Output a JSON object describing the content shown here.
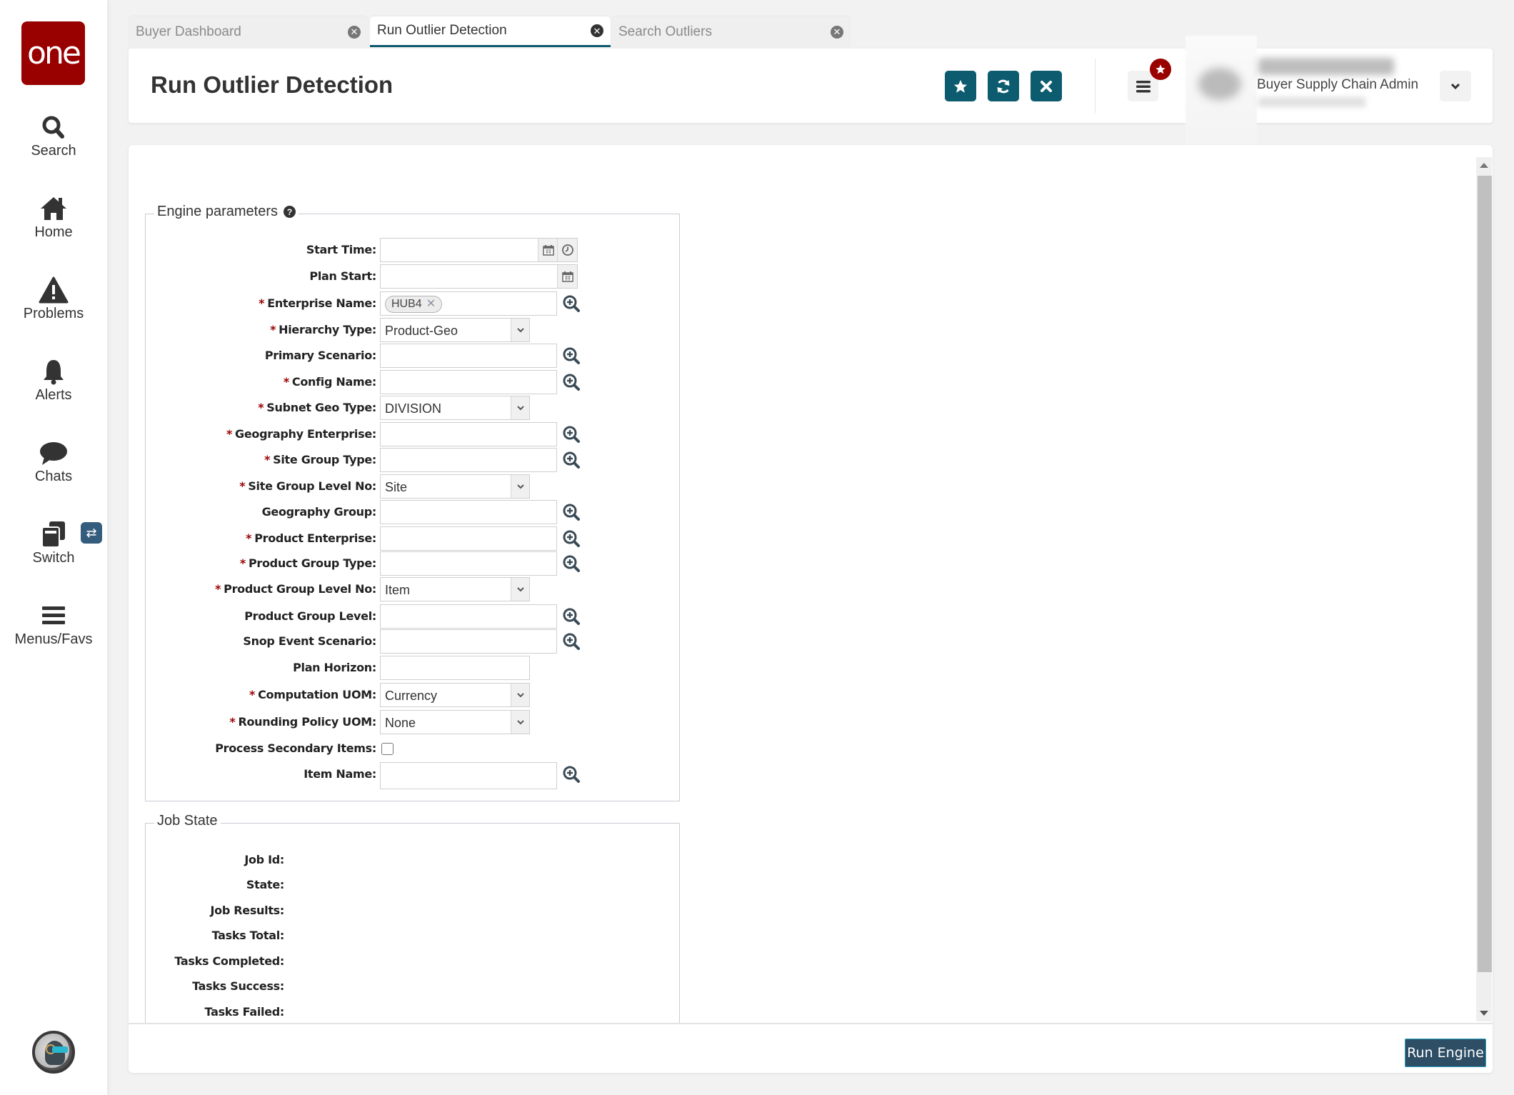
{
  "sidebar": {
    "logo_text": "one",
    "items": [
      {
        "label": "Search",
        "icon": "search-icon"
      },
      {
        "label": "Home",
        "icon": "home-icon"
      },
      {
        "label": "Problems",
        "icon": "warning-icon"
      },
      {
        "label": "Alerts",
        "icon": "bell-icon"
      },
      {
        "label": "Chats",
        "icon": "chat-icon"
      },
      {
        "label": "Switch",
        "icon": "switch-icon"
      },
      {
        "label": "Menus/Favs",
        "icon": "menu-icon"
      }
    ],
    "switch_badge": "⇄"
  },
  "tabs": [
    {
      "label": "Buyer Dashboard",
      "active": false
    },
    {
      "label": "Run Outlier Detection",
      "active": true
    },
    {
      "label": "Search Outliers",
      "active": false
    }
  ],
  "header": {
    "title": "Run Outlier Detection",
    "user_role": "Buyer Supply Chain Admin",
    "colors": {
      "accent": "#0d5b6e",
      "badge": "#990000",
      "brand": "#990000"
    }
  },
  "engine_parameters": {
    "legend": "Engine parameters",
    "fields": [
      {
        "label": "Start Time:",
        "required": false,
        "type": "datetime",
        "value": ""
      },
      {
        "label": "Plan Start:",
        "required": false,
        "type": "date",
        "value": ""
      },
      {
        "label": "Enterprise Name:",
        "required": true,
        "type": "chip-lookup",
        "value": "HUB4"
      },
      {
        "label": "Hierarchy Type:",
        "required": true,
        "type": "select",
        "value": "Product-Geo"
      },
      {
        "label": "Primary Scenario:",
        "required": false,
        "type": "lookup",
        "value": ""
      },
      {
        "label": "Config Name:",
        "required": true,
        "type": "lookup",
        "value": ""
      },
      {
        "label": "Subnet Geo Type:",
        "required": true,
        "type": "select",
        "value": "DIVISION"
      },
      {
        "label": "Geography Enterprise:",
        "required": true,
        "type": "lookup",
        "value": ""
      },
      {
        "label": "Site Group Type:",
        "required": true,
        "type": "lookup",
        "value": ""
      },
      {
        "label": "Site Group Level No:",
        "required": true,
        "type": "select",
        "value": "Site"
      },
      {
        "label": "Geography Group:",
        "required": false,
        "type": "lookup",
        "value": ""
      },
      {
        "label": "Product Enterprise:",
        "required": true,
        "type": "lookup",
        "value": ""
      },
      {
        "label": "Product Group Type:",
        "required": true,
        "type": "lookup",
        "value": ""
      },
      {
        "label": "Product Group Level No:",
        "required": true,
        "type": "select",
        "value": "Item"
      },
      {
        "label": "Product Group Level:",
        "required": false,
        "type": "lookup",
        "value": ""
      },
      {
        "label": "Snop Event Scenario:",
        "required": false,
        "type": "lookup",
        "value": ""
      },
      {
        "label": "Plan Horizon:",
        "required": false,
        "type": "text",
        "value": ""
      },
      {
        "label": "Computation UOM:",
        "required": true,
        "type": "select",
        "value": "Currency"
      },
      {
        "label": "Rounding Policy UOM:",
        "required": true,
        "type": "select",
        "value": "None"
      },
      {
        "label": "Process Secondary Items:",
        "required": false,
        "type": "checkbox",
        "value": false
      },
      {
        "label": "Item Name:",
        "required": false,
        "type": "lookup",
        "value": ""
      }
    ]
  },
  "job_state": {
    "legend": "Job State",
    "fields": [
      {
        "label": "Job Id:",
        "value": ""
      },
      {
        "label": "State:",
        "value": ""
      },
      {
        "label": "Job Results:",
        "value": ""
      },
      {
        "label": "Tasks Total:",
        "value": ""
      },
      {
        "label": "Tasks Completed:",
        "value": ""
      },
      {
        "label": "Tasks Success:",
        "value": ""
      },
      {
        "label": "Tasks Failed:",
        "value": ""
      }
    ]
  },
  "footer": {
    "run_label": "Run Engine",
    "run_color": "#2e4e66"
  },
  "required_marker": "*"
}
